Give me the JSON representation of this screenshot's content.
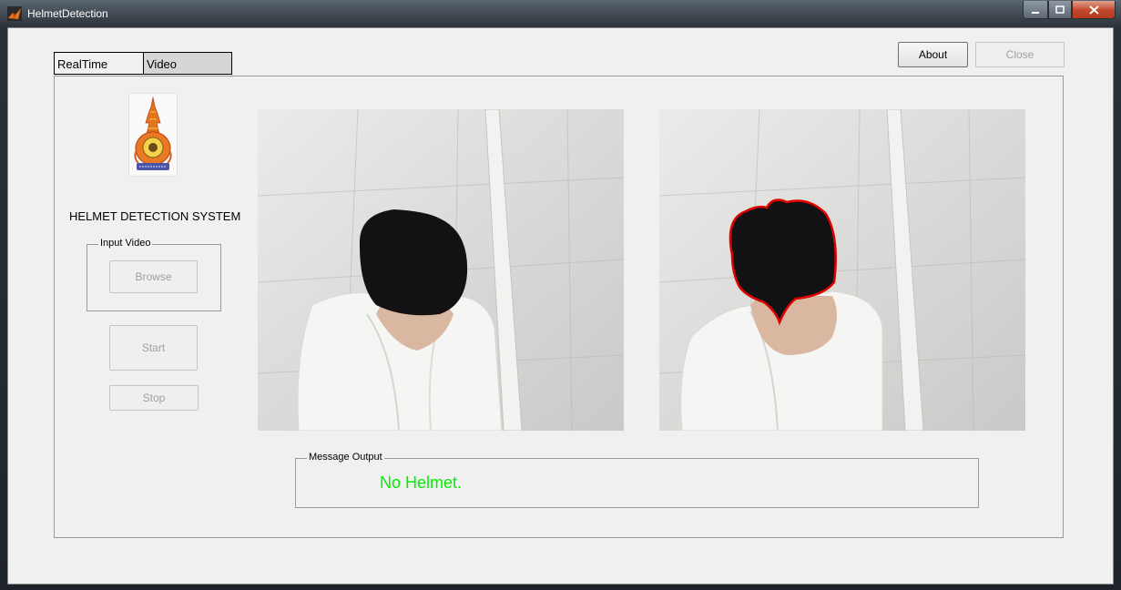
{
  "window": {
    "title": "HelmetDetection"
  },
  "tabs": [
    {
      "label": "RealTime"
    },
    {
      "label": "Video"
    }
  ],
  "toolbar": {
    "about_label": "About",
    "close_label": "Close"
  },
  "sidebar": {
    "system_title": "HELMET DETECTION SYSTEM",
    "input_group_label": "Input Video",
    "browse_label": "Browse",
    "start_label": "Start",
    "stop_label": "Stop"
  },
  "output": {
    "group_label": "Message Output",
    "message": "No Helmet.",
    "message_color": "#00ee00"
  },
  "colors": {
    "detection_outline": "#e00000"
  }
}
